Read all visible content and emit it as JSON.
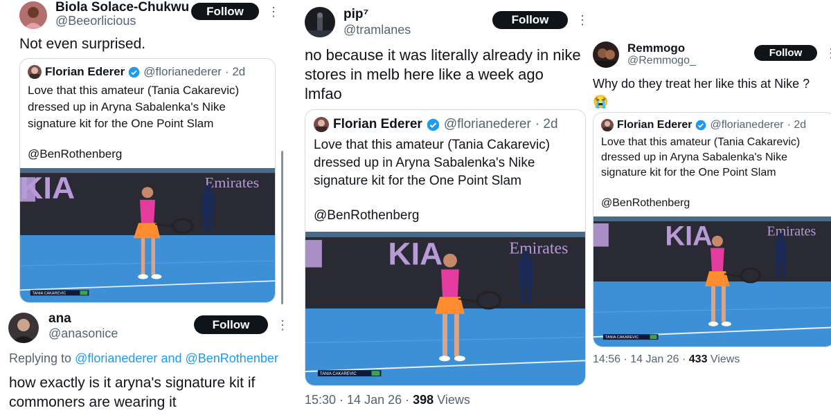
{
  "colors": {
    "accent": "#1d9bf0",
    "follow_bg": "#0f1419",
    "secondary_text": "#536471",
    "court": "#3d8fd6",
    "court_wall": "#2a2a35",
    "kia_letters": "#b79ad6"
  },
  "icons": [
    "more-options-icon",
    "verified-badge-icon",
    "crying-face-emoji"
  ],
  "left": {
    "tweet1": {
      "display_name": "Biola Solace-Chukwu",
      "handle": "@Beeorlicious",
      "follow_label": "Follow",
      "text": "Not even surprised.",
      "quote": {
        "display_name": "Florian Ederer",
        "handle": "@florianederer",
        "time": "· 2d",
        "text": "Love that this amateur (Tania Cakarevic) dressed up in Aryna Sabalenka's Nike signature kit for the One Point Slam",
        "mention": "@BenRothenberg",
        "scoreboard": "TANIA CAKAREVIC",
        "sponsor_logo": "KIA",
        "sponsor_2": "Emirates"
      }
    },
    "tweet2": {
      "display_name": "ana",
      "handle": "@anasonice",
      "follow_label": "Follow",
      "replying_prefix": "Replying to",
      "replying_user1": "@florianederer",
      "replying_and": "and",
      "replying_user2": "@BenRothenber",
      "text": "how exactly is it aryna's signature kit if commoners are wearing it"
    }
  },
  "middle": {
    "display_name": "pip⁷",
    "handle": "@tramlanes",
    "follow_label": "Follow",
    "text": "no because it was literally already in nike stores in melb here like a week ago lmfao",
    "quote": {
      "display_name": "Florian Ederer",
      "handle": "@florianederer",
      "time": "· 2d",
      "text": "Love that this amateur (Tania Cakarevic) dressed up in Aryna Sabalenka's Nike signature kit for the One Point Slam",
      "mention": "@BenRothenberg",
      "scoreboard": "TANIA CAKAREVIC",
      "sponsor_logo": "KIA",
      "sponsor_2": "Emirates"
    },
    "meta": {
      "time_date": "15:30 · 14 Jan 26 ·",
      "views_count": "398",
      "views_label": "Views"
    }
  },
  "right": {
    "display_name": "Remmogo",
    "handle": "@Remmogo_",
    "follow_label": "Follow",
    "text": "Why do they treat her like this at Nike ?",
    "emoji": "😭",
    "quote": {
      "display_name": "Florian Ederer",
      "handle": "@florianederer",
      "time": "· 2d",
      "text": "Love that this amateur (Tania Cakarevic) dressed up in Aryna Sabalenka's Nike signature kit for the One Point Slam",
      "mention": "@BenRothenberg",
      "scoreboard": "TANIA CAKAREVIC",
      "sponsor_logo": "KIA",
      "sponsor_2": "Emirates"
    },
    "meta": {
      "time_date": "14:56 · 14 Jan 26 ·",
      "views_count": "433",
      "views_label": "Views"
    }
  }
}
